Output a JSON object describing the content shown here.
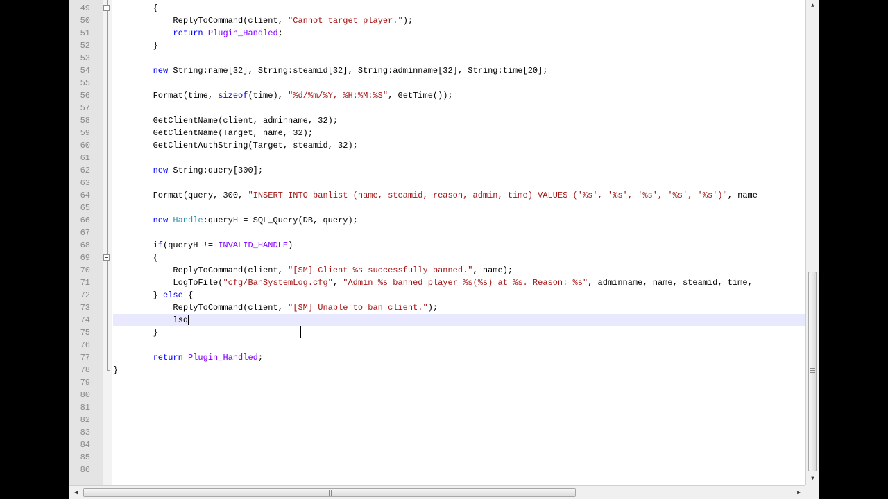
{
  "editor": {
    "current_line": 74,
    "lines": [
      {
        "n": "49",
        "segs": [
          [
            "",
            "        {"
          ]
        ]
      },
      {
        "n": "50",
        "segs": [
          [
            "",
            "            ReplyToCommand(client, "
          ],
          [
            "st",
            "\"Cannot target player.\""
          ],
          [
            "",
            ");"
          ]
        ]
      },
      {
        "n": "51",
        "segs": [
          [
            "",
            "            "
          ],
          [
            "kw",
            "return"
          ],
          [
            "",
            " "
          ],
          [
            "fn",
            "Plugin_Handled"
          ],
          [
            "",
            ";"
          ]
        ]
      },
      {
        "n": "52",
        "segs": [
          [
            "",
            "        }"
          ]
        ]
      },
      {
        "n": "53",
        "segs": [
          [
            "",
            ""
          ]
        ]
      },
      {
        "n": "54",
        "segs": [
          [
            "",
            "        "
          ],
          [
            "kw",
            "new"
          ],
          [
            "",
            " String:name[32], String:steamid[32], String:adminname[32], String:time[20];"
          ]
        ]
      },
      {
        "n": "55",
        "segs": [
          [
            "",
            ""
          ]
        ]
      },
      {
        "n": "56",
        "segs": [
          [
            "",
            "        Format(time, "
          ],
          [
            "kw",
            "sizeof"
          ],
          [
            "",
            "(time), "
          ],
          [
            "st",
            "\"%d/%m/%Y, %H:%M:%S\""
          ],
          [
            "",
            ", GetTime());"
          ]
        ]
      },
      {
        "n": "57",
        "segs": [
          [
            "",
            ""
          ]
        ]
      },
      {
        "n": "58",
        "segs": [
          [
            "",
            "        GetClientName(client, adminname, 32);"
          ]
        ]
      },
      {
        "n": "59",
        "segs": [
          [
            "",
            "        GetClientName(Target, name, 32);"
          ]
        ]
      },
      {
        "n": "60",
        "segs": [
          [
            "",
            "        GetClientAuthString(Target, steamid, 32);"
          ]
        ]
      },
      {
        "n": "61",
        "segs": [
          [
            "",
            ""
          ]
        ]
      },
      {
        "n": "62",
        "segs": [
          [
            "",
            "        "
          ],
          [
            "kw",
            "new"
          ],
          [
            "",
            " String:query[300];"
          ]
        ]
      },
      {
        "n": "63",
        "segs": [
          [
            "",
            ""
          ]
        ]
      },
      {
        "n": "64",
        "segs": [
          [
            "",
            "        Format(query, 300, "
          ],
          [
            "st",
            "\"INSERT INTO banlist (name, steamid, reason, admin, time) VALUES ('%s', '%s', '%s', '%s', '%s')\""
          ],
          [
            "",
            ", name"
          ]
        ]
      },
      {
        "n": "65",
        "segs": [
          [
            "",
            ""
          ]
        ]
      },
      {
        "n": "66",
        "segs": [
          [
            "",
            "        "
          ],
          [
            "kw",
            "new"
          ],
          [
            "",
            " "
          ],
          [
            "ty",
            "Handle"
          ],
          [
            "",
            ":queryH = SQL_Query(DB, query);"
          ]
        ]
      },
      {
        "n": "67",
        "segs": [
          [
            "",
            ""
          ]
        ]
      },
      {
        "n": "68",
        "segs": [
          [
            "",
            "        "
          ],
          [
            "kw",
            "if"
          ],
          [
            "",
            "(queryH != "
          ],
          [
            "fn",
            "INVALID_HANDLE"
          ],
          [
            "",
            ")"
          ]
        ]
      },
      {
        "n": "69",
        "segs": [
          [
            "",
            "        {"
          ]
        ]
      },
      {
        "n": "70",
        "segs": [
          [
            "",
            "            ReplyToCommand(client, "
          ],
          [
            "st",
            "\"[SM] Client %s successfully banned.\""
          ],
          [
            "",
            ", name);"
          ]
        ]
      },
      {
        "n": "71",
        "segs": [
          [
            "",
            "            LogToFile("
          ],
          [
            "st",
            "\"cfg/BanSystemLog.cfg\""
          ],
          [
            "",
            ", "
          ],
          [
            "st",
            "\"Admin %s banned player %s(%s) at %s. Reason: %s\""
          ],
          [
            "",
            ", adminname, name, steamid, time,"
          ]
        ]
      },
      {
        "n": "72",
        "segs": [
          [
            "",
            "        } "
          ],
          [
            "kw",
            "else"
          ],
          [
            "",
            " {"
          ]
        ]
      },
      {
        "n": "73",
        "segs": [
          [
            "",
            "            ReplyToCommand(client, "
          ],
          [
            "st",
            "\"[SM] Unable to ban client.\""
          ],
          [
            "",
            ");"
          ]
        ]
      },
      {
        "n": "74",
        "segs": [
          [
            "",
            "            lsq"
          ]
        ]
      },
      {
        "n": "75",
        "segs": [
          [
            "",
            "        }"
          ]
        ]
      },
      {
        "n": "76",
        "segs": [
          [
            "",
            ""
          ]
        ]
      },
      {
        "n": "77",
        "segs": [
          [
            "",
            "        "
          ],
          [
            "kw",
            "return"
          ],
          [
            "",
            " "
          ],
          [
            "fn",
            "Plugin_Handled"
          ],
          [
            "",
            ";"
          ]
        ]
      },
      {
        "n": "78",
        "segs": [
          [
            "",
            "}"
          ]
        ]
      },
      {
        "n": "79",
        "segs": [
          [
            "",
            ""
          ]
        ]
      },
      {
        "n": "80",
        "segs": [
          [
            "",
            ""
          ]
        ]
      },
      {
        "n": "81",
        "segs": [
          [
            "",
            ""
          ]
        ]
      },
      {
        "n": "82",
        "segs": [
          [
            "",
            ""
          ]
        ]
      },
      {
        "n": "83",
        "segs": [
          [
            "",
            ""
          ]
        ]
      },
      {
        "n": "84",
        "segs": [
          [
            "",
            ""
          ]
        ]
      },
      {
        "n": "85",
        "segs": [
          [
            "",
            ""
          ]
        ]
      },
      {
        "n": "86",
        "segs": [
          [
            "",
            ""
          ]
        ]
      }
    ]
  },
  "colors": {
    "keyword": "#0000ff",
    "type": "#2b91af",
    "constant": "#8000ff",
    "string": "#a31515",
    "current_line": "#e8e8ff",
    "gutter": "#e4e4e4"
  },
  "icons": {
    "fold_marker": "fold-minus-icon",
    "scroll_up": "arrow-up-icon",
    "scroll_down": "arrow-down-icon",
    "scroll_left": "arrow-left-icon",
    "scroll_right": "arrow-right-icon",
    "mouse": "text-ibeam-cursor-icon"
  }
}
